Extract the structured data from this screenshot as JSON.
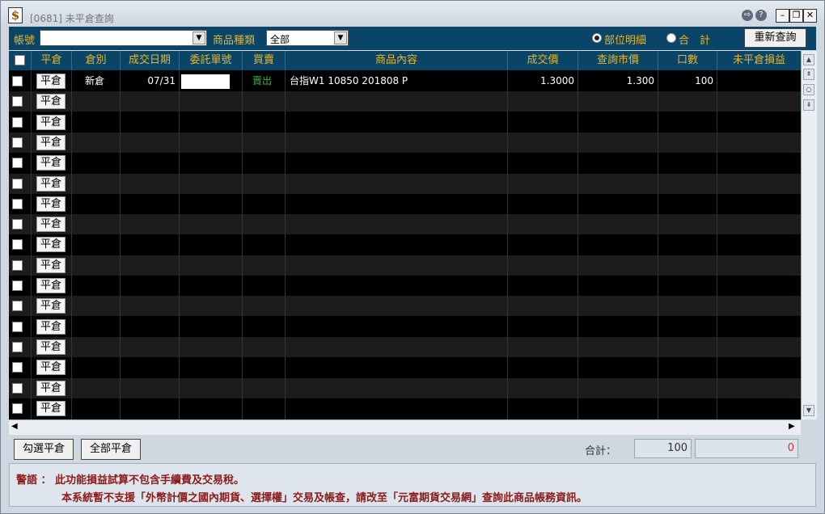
{
  "window": {
    "title": "[0681] 未平倉查詢",
    "app_icon": "$"
  },
  "title_buttons": {
    "help": "?",
    "restore": "❐",
    "minimize": "—",
    "maximize": "❐",
    "close": "✕"
  },
  "toolbar": {
    "account_label": "帳號",
    "account_value": "",
    "product_type_label": "商品種類",
    "product_type_value": "全部",
    "radio_detail_label": "部位明細",
    "radio_total_label": "合　計",
    "radio_selected": "detail",
    "requery_label": "重新查詢"
  },
  "table": {
    "headers": [
      "",
      "平倉",
      "倉別",
      "成交日期",
      "委託單號",
      "買賣",
      "商品內容",
      "成交價",
      "查詢市價",
      "口數",
      "未平倉損益"
    ],
    "close_button_label": "平倉",
    "row_count": 17,
    "rows": [
      {
        "type": "新倉",
        "date": "07/31",
        "order_no": "",
        "side": "賣出",
        "product": "台指W1  10850  201808  P",
        "trade_price": "1.3000",
        "market_price": "1.300",
        "qty": "100",
        "pnl": ""
      }
    ]
  },
  "bottom": {
    "select_close_label": "勾選平倉",
    "close_all_label": "全部平倉",
    "total_label": "合計：",
    "total_qty": "100",
    "total_pnl": "0"
  },
  "notice": {
    "label": "警語 ：",
    "line1": "此功能損益試算不包含手續費及交易稅。",
    "line2": "本系統暫不支援「外幣計價之國內期貨、選擇權」交易及帳查，請改至「元富期貨交易網」查詢此商品帳務資訊。"
  },
  "colors": {
    "header_bg": "#0a4567",
    "header_text": "#e7b52a",
    "sell": "#3cb043",
    "notice_text": "#8b1a1a",
    "pnl": "#d83030"
  }
}
